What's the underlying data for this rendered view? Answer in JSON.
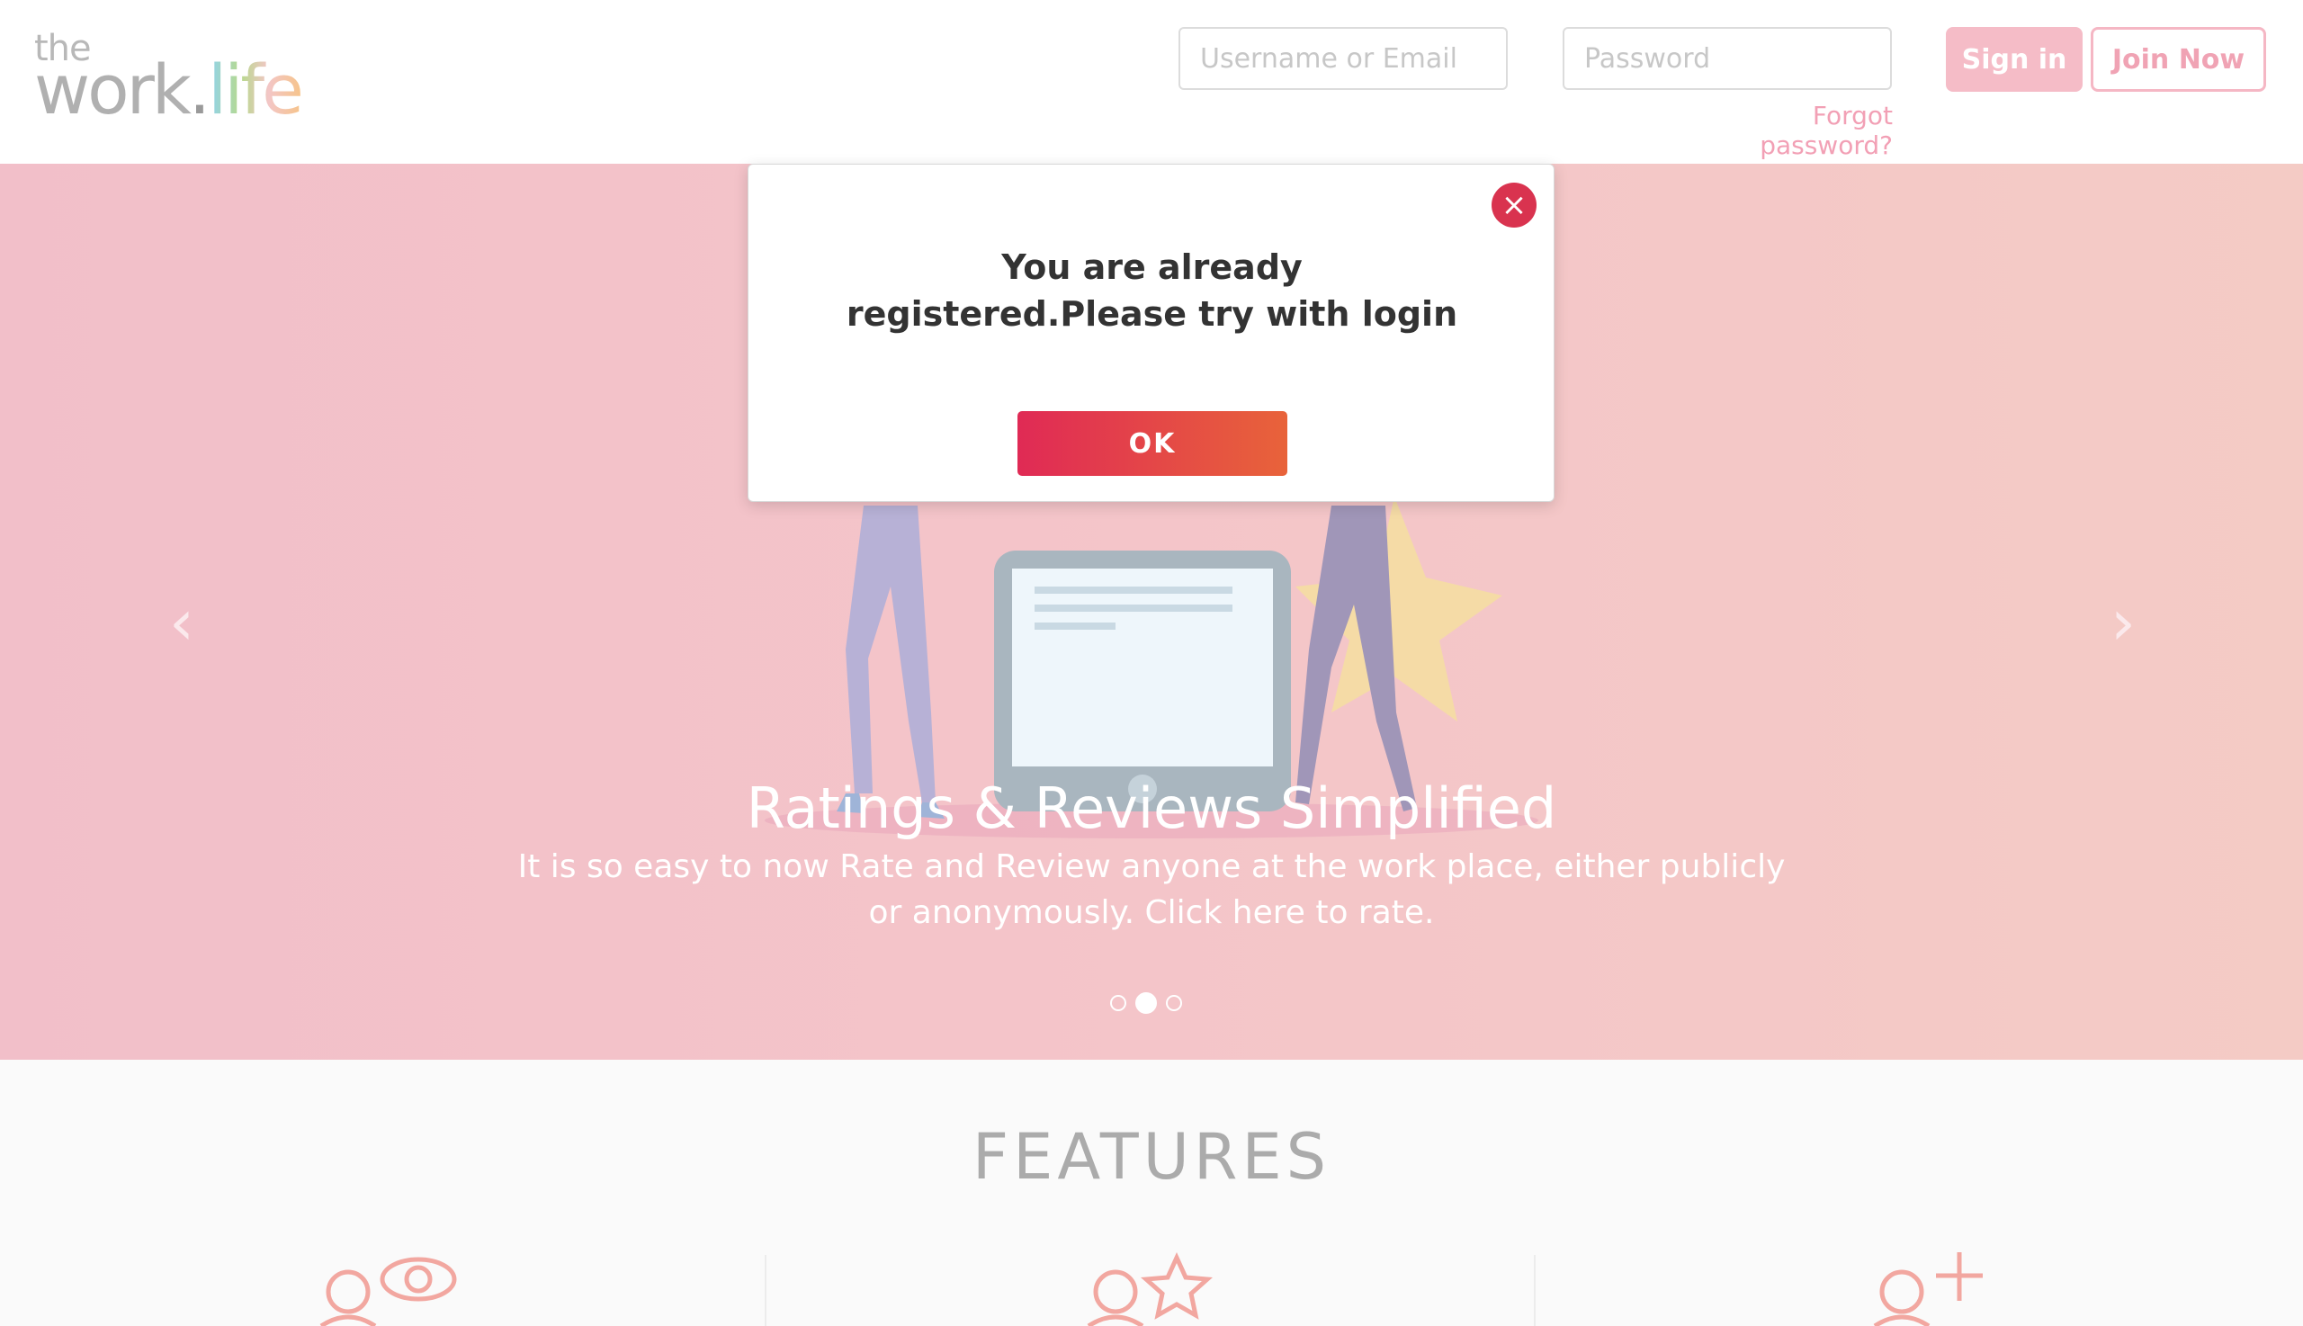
{
  "header": {
    "logo": {
      "top": "the",
      "word": "work",
      "dot": ".",
      "life": "life"
    },
    "username": {
      "placeholder": "Username or Email",
      "value": ""
    },
    "password": {
      "placeholder": "Password",
      "value": ""
    },
    "forgot_label": "Forgot password?",
    "signin_label": "Sign in",
    "join_label": "Join Now"
  },
  "hero": {
    "prev_icon": "chevron-left",
    "next_icon": "chevron-right",
    "prev_glyph": "‹",
    "next_glyph": "›",
    "title": "Ratings & Reviews Simplified",
    "text": "It is so easy to now Rate and Review anyone at the work place, either publicly or anonymously. Click here to rate.",
    "slides": 3,
    "active_slide": 2
  },
  "features": {
    "title": "FEATURES",
    "icons": [
      "user-eye-icon",
      "user-star-icon",
      "user-plus-icon"
    ]
  },
  "modal": {
    "close_glyph": "×",
    "message": "You are already registered.Please try with login",
    "ok_label": "OK"
  },
  "colors": {
    "accent": "#e02a55",
    "accent_end": "#e8633a",
    "hero_bg": "#f2bfc9",
    "link": "#f2a0b5"
  }
}
